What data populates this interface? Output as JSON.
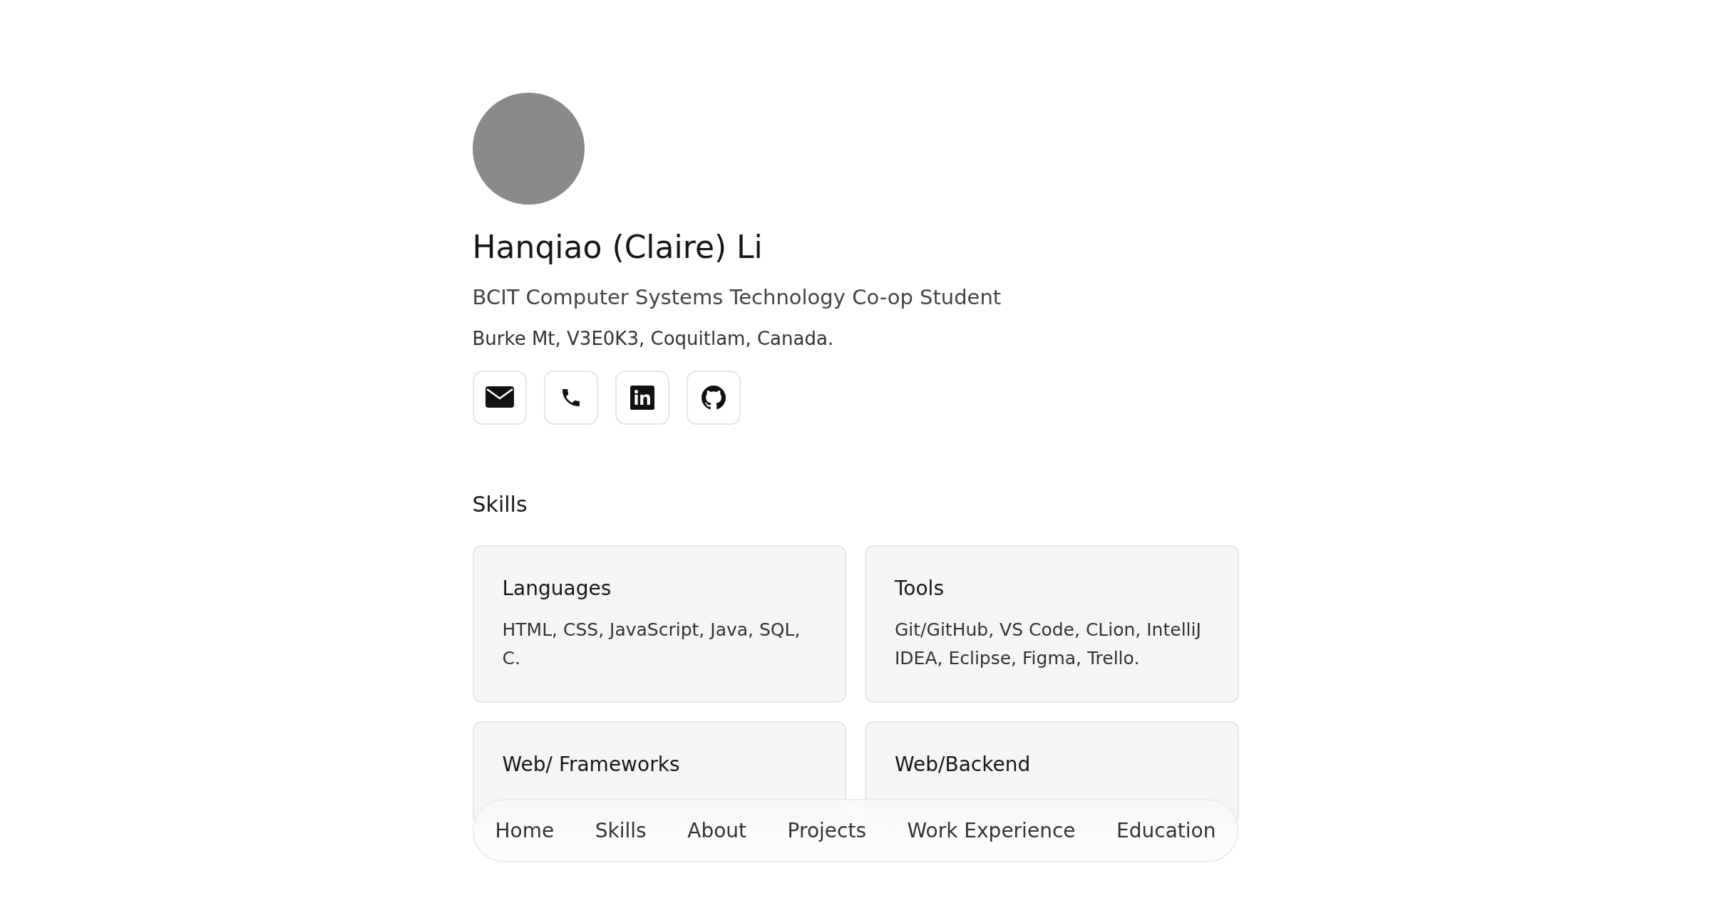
{
  "profile": {
    "name": "Hanqiao (Claire) Li",
    "title": "BCIT Computer Systems Technology Co-op Student",
    "location": "Burke Mt, V3E0K3, Coquitlam, Canada.",
    "contacts": [
      {
        "kind": "email"
      },
      {
        "kind": "phone"
      },
      {
        "kind": "linkedin"
      },
      {
        "kind": "github"
      }
    ]
  },
  "skills": {
    "heading": "Skills",
    "cards": [
      {
        "title": "Languages",
        "body": "HTML, CSS, JavaScript, Java, SQL, C."
      },
      {
        "title": "Tools",
        "body": "Git/GitHub, VS Code, CLion, IntelliJ IDEA, Eclipse, Figma, Trello."
      },
      {
        "title": "Web/ Frameworks"
      },
      {
        "title": "Web/Backend"
      }
    ]
  },
  "nav": [
    "Home",
    "Skills",
    "About",
    "Projects",
    "Work Experience",
    "Education"
  ]
}
